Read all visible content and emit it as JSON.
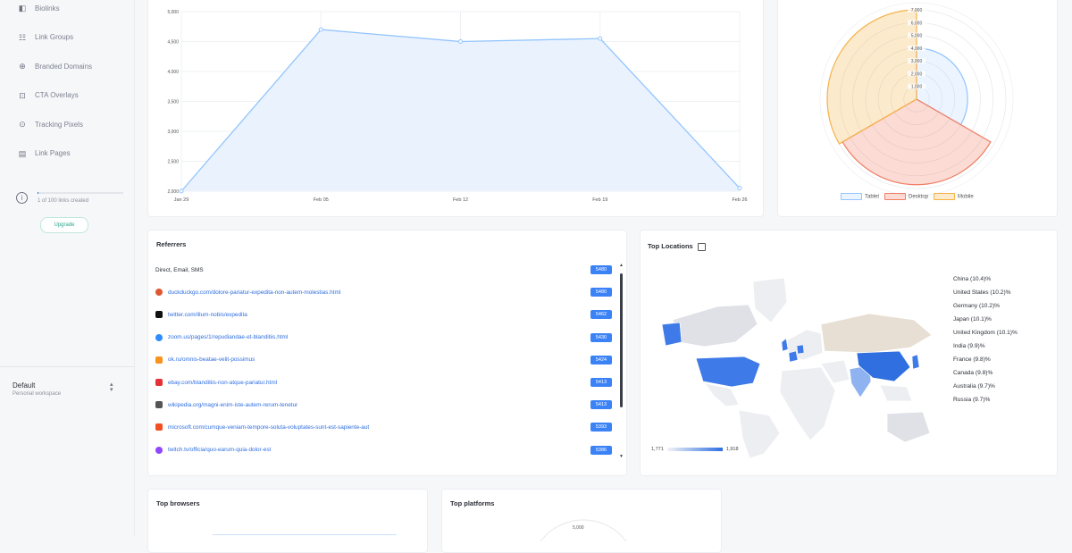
{
  "sidebar": {
    "items": [
      {
        "label": "Biolinks",
        "icon": "biolinks-icon"
      },
      {
        "label": "Link Groups",
        "icon": "link-groups-icon"
      },
      {
        "label": "Branded Domains",
        "icon": "globe-icon"
      },
      {
        "label": "CTA Overlays",
        "icon": "cta-overlay-icon"
      },
      {
        "label": "Tracking Pixels",
        "icon": "pixel-icon"
      },
      {
        "label": "Link Pages",
        "icon": "link-pages-icon"
      }
    ],
    "usage": {
      "text": "1 of 100 links created",
      "fraction": 0.01
    },
    "upgrade_label": "Upgrade",
    "workspace": {
      "name": "Default",
      "subtitle": "Personal workspace"
    }
  },
  "clicks_chart": {
    "chart_data": {
      "type": "area",
      "x": [
        "Jan 29",
        "Feb 05",
        "Feb 12",
        "Feb 19",
        "Feb 26"
      ],
      "values": [
        2000,
        4700,
        4500,
        4550,
        2050
      ],
      "yticks": [
        "2,000",
        "2,500",
        "3,000",
        "3,500",
        "4,000",
        "4,500",
        "5,000"
      ],
      "ylim": [
        2000,
        5000
      ],
      "color": "#93c5fd"
    }
  },
  "devices_chart": {
    "chart_data": {
      "type": "polar",
      "series": [
        {
          "name": "Tablet",
          "value": 4000,
          "color": "#93c5fd"
        },
        {
          "name": "Desktop",
          "value": 6700,
          "color": "#ef7d63"
        },
        {
          "name": "Mobile",
          "value": 7000,
          "color": "#f4b24a"
        }
      ],
      "rticks": [
        "1,000",
        "2,000",
        "3,000",
        "4,000",
        "5,000",
        "6,000",
        "7,000"
      ],
      "rmax": 7000
    }
  },
  "referrers": {
    "title": "Referrers",
    "rows": [
      {
        "label": "Direct, Email, SMS",
        "count": "5480",
        "link": false,
        "icon_color": "#ffffff"
      },
      {
        "label": "duckduckgo.com/dolore-pariatur-expedita-non-autem-molestias.html",
        "count": "5480",
        "link": true,
        "icon_color": "#de5833"
      },
      {
        "label": "twitter.com/illum-nobis/expedita",
        "count": "5462",
        "link": true,
        "icon_color": "#111111"
      },
      {
        "label": "zoom.us/pages/1/repudiandae-et-blanditiis.html",
        "count": "5430",
        "link": true,
        "icon_color": "#2d8cff"
      },
      {
        "label": "ok.ru/omnis-beatae-velit-possimus",
        "count": "5424",
        "link": true,
        "icon_color": "#f7931e"
      },
      {
        "label": "ebay.com/blanditiis-non-atque-pariatur.html",
        "count": "5413",
        "link": true,
        "icon_color": "#e53238"
      },
      {
        "label": "wikipedia.org/magni-enim-iste-autem-rerum-tenetur",
        "count": "5413",
        "link": true,
        "icon_color": "#555555"
      },
      {
        "label": "microsoft.com/cumque-veniam-tempore-soluta-voluptates-sunt-est-sapiente-aut",
        "count": "5393",
        "link": true,
        "icon_color": "#f25022"
      },
      {
        "label": "twitch.tv/officia/quo-earum-quia-dolor-est",
        "count": "5386",
        "link": true,
        "icon_color": "#9146ff"
      }
    ]
  },
  "locations": {
    "title": "Top Locations",
    "items": [
      "China (10.4)%",
      "United States (10.2)%",
      "Germany (10.2)%",
      "Japan (10.1)%",
      "United Kingdom (10.1)%",
      "India (9.9)%",
      "France (9.8)%",
      "Canada (9.8)%",
      "Australia (9.7)%",
      "Russia (9.7)%"
    ],
    "scale": {
      "min": "1,771",
      "max": "1,918"
    }
  },
  "browsers": {
    "title": "Top browsers"
  },
  "platforms": {
    "title": "Top platforms",
    "top_tick": "5,000"
  }
}
